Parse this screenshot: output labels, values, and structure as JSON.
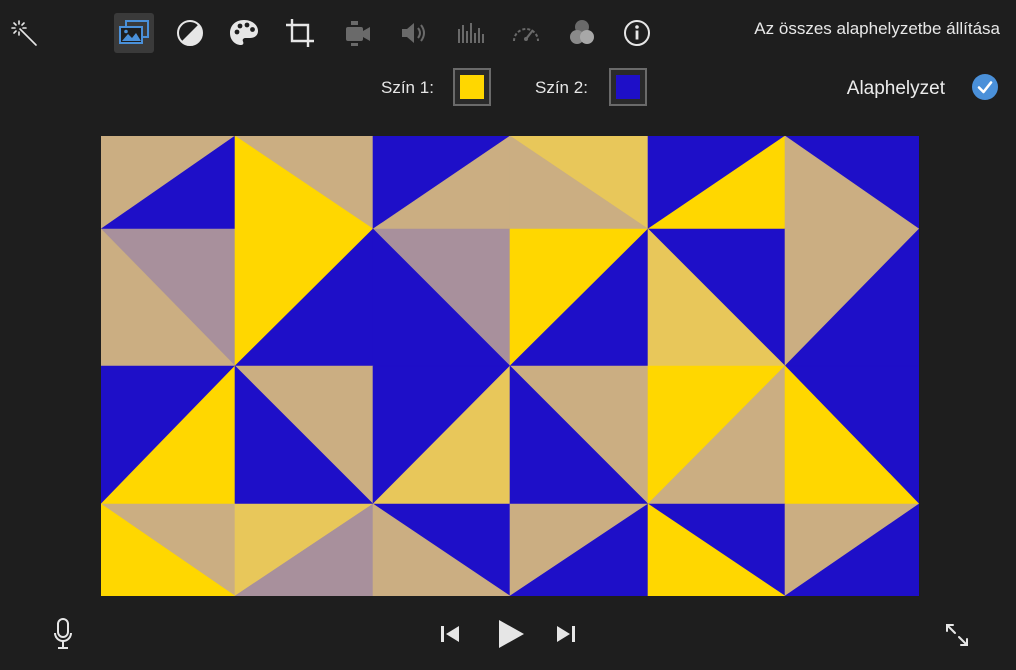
{
  "toolbar": {
    "reset_all_label": "Az összes alaphelyzetbe állítása",
    "icons": [
      "magic-wand-icon",
      "image-background-icon",
      "color-balance-icon",
      "palette-icon",
      "crop-icon",
      "video-stabilization-icon",
      "volume-icon",
      "equalizer-icon",
      "speed-icon",
      "clip-filter-icon",
      "info-icon"
    ],
    "active_icon": "image-background-icon"
  },
  "colors": {
    "color1_label": "Szín 1:",
    "color1_value": "#ffd700",
    "color2_label": "Szín 2:",
    "color2_value": "#1e0fc8",
    "default_label": "Alaphelyzet",
    "accent": "#4a90d9"
  },
  "pattern": {
    "palette": [
      "#1e0fc8",
      "#ffd700",
      "#cbae82",
      "#e8c75a",
      "#a8909c"
    ]
  },
  "bottom": {
    "icons": [
      "microphone-icon",
      "previous-icon",
      "play-icon",
      "next-icon",
      "fullscreen-icon"
    ]
  }
}
